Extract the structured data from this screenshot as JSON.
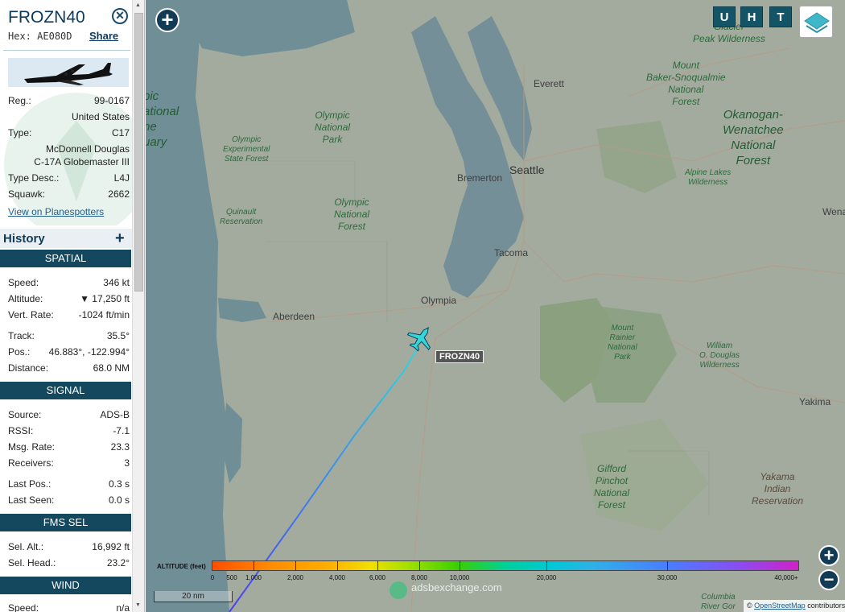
{
  "aircraft": {
    "callsign": "FROZN40",
    "hex_label": "Hex:",
    "hex": "AE080D",
    "share": "Share",
    "details": [
      {
        "key": "Reg.:",
        "value": "99-0167"
      },
      {
        "key": "Country",
        "value": "United States"
      },
      {
        "key": "Type:",
        "value": "C17"
      },
      {
        "key": "Model",
        "value": "McDonnell Douglas"
      },
      {
        "key": "Model2",
        "value": "C-17A Globemaster III"
      },
      {
        "key": "Type Desc.:",
        "value": "L4J"
      },
      {
        "key": "Squawk:",
        "value": "2662"
      }
    ],
    "planespotters_link": "View on Planespotters"
  },
  "history": {
    "label": "History",
    "add": "+"
  },
  "spatial": {
    "header": "SPATIAL",
    "rows": [
      {
        "key": "Speed:",
        "value": "346 kt"
      },
      {
        "key": "Altitude:",
        "value": "▼ 17,250 ft"
      },
      {
        "key": "Vert. Rate:",
        "value": "-1024 ft/min"
      },
      {
        "key": "Track:",
        "value": "35.5°"
      },
      {
        "key": "Pos.:",
        "value": "46.883°, -122.994°"
      },
      {
        "key": "Distance:",
        "value": "68.0 NM"
      }
    ]
  },
  "signal": {
    "header": "SIGNAL",
    "rows": [
      {
        "key": "Source:",
        "value": "ADS-B"
      },
      {
        "key": "RSSI:",
        "value": "-7.1"
      },
      {
        "key": "Msg. Rate:",
        "value": "23.3"
      },
      {
        "key": "Receivers:",
        "value": "3"
      },
      {
        "key": "Last Pos.:",
        "value": "0.3 s"
      },
      {
        "key": "Last Seen:",
        "value": "0.0 s"
      }
    ]
  },
  "fms": {
    "header": "FMS SEL",
    "rows": [
      {
        "key": "Sel. Alt.:",
        "value": "16,992 ft"
      },
      {
        "key": "Sel. Head.:",
        "value": "23.2°"
      }
    ]
  },
  "wind": {
    "header": "WIND",
    "rows": [
      {
        "key": "Speed:",
        "value": "n/a"
      }
    ]
  },
  "map": {
    "buttons": {
      "zoom_in_top": "+",
      "u": "U",
      "h": "H",
      "t": "T",
      "zoom_in": "+",
      "zoom_out": "−"
    },
    "aircraft_label": "FROZN40",
    "labels": {
      "everett": "Everett",
      "seattle": "Seattle",
      "bremerton": "Bremerton",
      "tacoma": "Tacoma",
      "olympia": "Olympia",
      "aberdeen": "Aberdeen",
      "yakima": "Yakima",
      "wena": "Wena",
      "olympic_np": "Olympic\nNational\nPark",
      "olympic_nf": "Olympic\nNational\nForest",
      "olympic_exp": "Olympic\nExperimental\nState Forest",
      "quinault": "Quinault\nReservation",
      "olympic_edge": "pic\national\nne\nuary",
      "glacier": "Glacier\nPeak Wilderness",
      "mt_baker": "Mount\nBaker-Snoqualmie\nNational\nForest",
      "okanogan": "Okanogan-\nWenatchee\nNational\nForest",
      "alpine": "Alpine Lakes\nWilderness",
      "rainier": "Mount\nRainier\nNational\nPark",
      "wm_douglas": "William\nO. Douglas\nWilderness",
      "gifford": "Gifford\nPinchot\nNational\nForest",
      "yakama": "Yakama\nIndian\nReservation",
      "columbia": "Columbia\nRiver Gor"
    },
    "altitude_legend": {
      "title": "ALTITUDE (feet)",
      "ticks": [
        "0",
        "500",
        "1,000",
        "2,000",
        "4,000",
        "6,000",
        "8,000",
        "10,000",
        "20,000",
        "30,000",
        "40,000+"
      ]
    },
    "scale": "20 nm",
    "watermark": "adsbexchange.com",
    "attribution_symbol": "©",
    "attribution_link": "OpenStreetMap",
    "attribution_rest": "contributors"
  },
  "colors": {
    "header_bg": "#14485e",
    "accent": "#0b3a5c",
    "track_start": "#4b3ef0",
    "track_end": "#2fd6e0"
  }
}
